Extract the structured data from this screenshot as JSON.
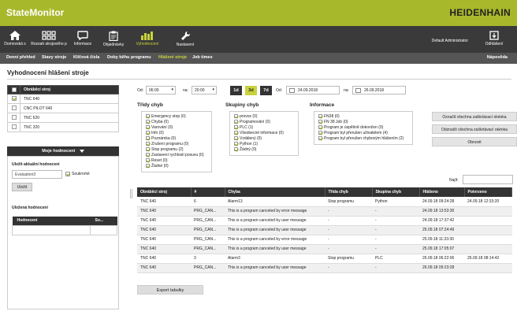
{
  "app": {
    "title": "StateMonitor",
    "brand": "HEIDENHAIN"
  },
  "main_nav": [
    {
      "label": "Domovská s",
      "icon": "home-icon"
    },
    {
      "label": "Rozsah strojového p",
      "icon": "grid-icon"
    },
    {
      "label": "Informace",
      "icon": "chat-icon"
    },
    {
      "label": "Objednávky",
      "icon": "clipboard-icon"
    },
    {
      "label": "Vyhodnocení",
      "icon": "bar-chart-icon",
      "active": true
    },
    {
      "label": "Nastavení",
      "icon": "wrench-icon"
    }
  ],
  "user": {
    "name": "Default Administrator",
    "logout_label": "Odhlášení",
    "logout_icon": "logout-icon"
  },
  "sub_nav": {
    "tabs": [
      "Denní přehled",
      "Stavy stroje",
      "Klíčová čísla",
      "Doby běhu programu",
      "Hlášení stroje",
      "Job times"
    ],
    "active": "Hlášení stroje",
    "help": "Nápověda"
  },
  "page_title": "Vyhodnocení hlášení stroje",
  "machines": {
    "header": "Obráběcí stroj",
    "rows": [
      {
        "name": "TNC 640",
        "checked": true
      },
      {
        "name": "CNC PILOT 640",
        "checked": false
      },
      {
        "name": "TNC 620",
        "checked": false
      },
      {
        "name": "TNC 320",
        "checked": false
      }
    ]
  },
  "ratings": {
    "button": "Moje hodnocení",
    "save_current_label": "Uložit aktuální hodnocení",
    "name_value": "Evaluation3",
    "private_label": "Soukromé",
    "save_button": "Uložit",
    "saved_label": "Uložená hodnocení",
    "saved_columns": [
      "Hodnocení",
      "So..."
    ]
  },
  "time_filter": {
    "from_label": "Od:",
    "from_time": "06:00",
    "to_label": "na:",
    "to_time": "20:00",
    "ranges": [
      "1d",
      "3d",
      "7d"
    ],
    "date_from_label": "Od:",
    "date_from": "24.09.2018",
    "date_to_label": "na:",
    "date_to": "26.09.2018"
  },
  "error_classes": {
    "title": "Třídy chyb",
    "items": [
      "Emergency stop (0)",
      "Chyba (0)",
      "Varování (0)",
      "Info (0)",
      "Poznámka (0)",
      "Zrušení programu (0)",
      "Stop programu (2)",
      "Zastavení rychlosti posuvu (0)",
      "Reset (0)",
      "Žádné (0)"
    ]
  },
  "error_groups": {
    "title": "Skupiny chyb",
    "items": [
      "provoz (0)",
      "Programování (0)",
      "PLC (1)",
      "Všeobecné informace (0)",
      "Vzdálený (0)",
      "Python (1)",
      "Žádný (0)"
    ]
  },
  "information": {
    "title": "Informace",
    "items": [
      "FN38 (0)",
      "FN 38 Job (0)",
      "Program je úspěšně dokončen (0)",
      "Program byl přerušen uživatelem (4)",
      "Program byl přerušen chybovým hlášením (2)"
    ]
  },
  "actions": {
    "select_all": "Označit všechna zaškrtávací okénka",
    "deselect_all": "Odznačit všechna zaškrtávací okénka",
    "refresh": "Obnovit"
  },
  "search_label": "Najít:",
  "events": {
    "columns": [
      "Obráběcí stroj",
      "#",
      "Chyba",
      "Třída chyb",
      "Skupina chyb",
      "Hlášeno",
      "Potvrzeno"
    ],
    "rows": [
      [
        "TNC 640",
        "6",
        "Alarm13",
        "Stop programu",
        "Python",
        "24.09.18 09:24:28",
        "24.09.18 12:33:20"
      ],
      [
        "TNC 640",
        "PRG_CAN...",
        "This is a program canceled by error message",
        "-",
        "-",
        "24.09.18 13:53:30",
        ""
      ],
      [
        "TNC 640",
        "PRG_CAN...",
        "This is a program canceled by user message",
        "-",
        "-",
        "24.09.18 17:37:42",
        ""
      ],
      [
        "TNC 640",
        "PRG_CAN...",
        "This is a program canceled by user message",
        "-",
        "-",
        "25.09.18 07:24:49",
        ""
      ],
      [
        "TNC 640",
        "PRG_CAN...",
        "This is a program canceled by error message",
        "-",
        "-",
        "25.09.18 11:33:30",
        ""
      ],
      [
        "TNC 640",
        "PRG_CAN...",
        "This is a program canceled by user message",
        "-",
        "-",
        "25.09.18 17:05:07",
        ""
      ],
      [
        "TNC 640",
        "3",
        "Alarm3",
        "Stop programu",
        "PLC",
        "26.09.18 06:22:06",
        "26.09.18 08:14:42"
      ],
      [
        "TNC 640",
        "PRG_CAN...",
        "This is a program canceled by user message",
        "-",
        "-",
        "26.09.18 09:23:28",
        ""
      ]
    ]
  },
  "export_button": "Export tabulky",
  "colors": {
    "accent": "#a8b82b",
    "nav": "#3a3a3a",
    "subnav": "#555555",
    "active_tab": "#c8d23c"
  }
}
